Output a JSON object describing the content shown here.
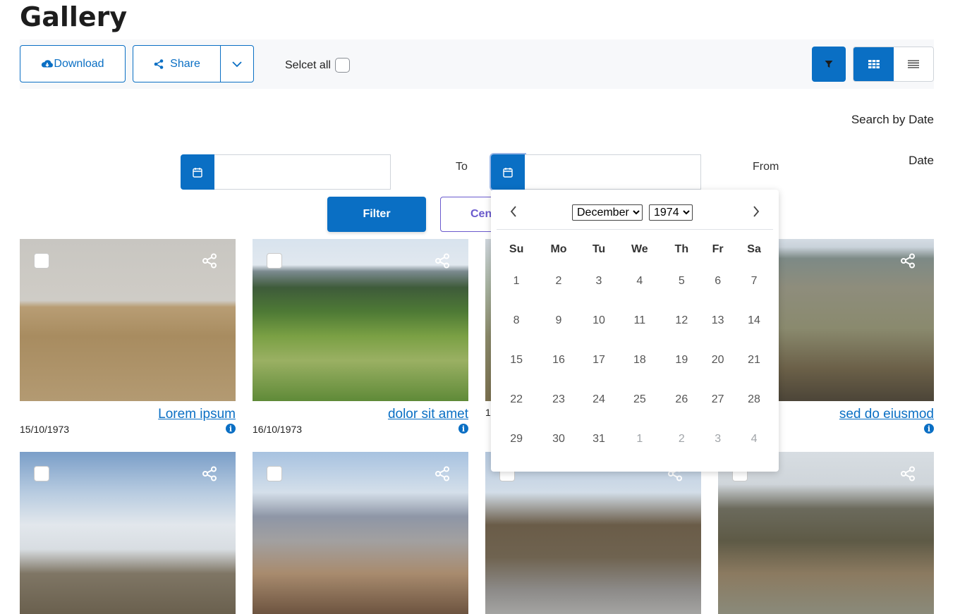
{
  "page": {
    "title": "Gallery"
  },
  "toolbar": {
    "download_label": "Download",
    "share_label": "Share",
    "select_all_label": "Selcet all"
  },
  "search": {
    "search_by_date": "Search by Date",
    "date_label": "Date",
    "to_label": "To",
    "from_label": "From",
    "filter_label": "Filter",
    "cancel_label": "Cen",
    "date_input_1": "",
    "date_input_2": ""
  },
  "datepicker": {
    "month": "December",
    "year": "1974",
    "weekdays": [
      "Su",
      "Mo",
      "Tu",
      "We",
      "Th",
      "Fr",
      "Sa"
    ],
    "weeks": [
      [
        "1",
        "2",
        "3",
        "4",
        "5",
        "6",
        "7"
      ],
      [
        "8",
        "9",
        "10",
        "11",
        "12",
        "13",
        "14"
      ],
      [
        "15",
        "16",
        "17",
        "18",
        "19",
        "20",
        "21"
      ],
      [
        "22",
        "23",
        "24",
        "25",
        "26",
        "27",
        "28"
      ],
      [
        "29",
        "30",
        "31",
        "1",
        "2",
        "3",
        "4"
      ]
    ]
  },
  "gallery": {
    "items": [
      {
        "title": "Lorem ipsum",
        "date": "15/10/1973"
      },
      {
        "title": "dolor sit amet",
        "date": "16/10/1973"
      },
      {
        "title": "",
        "date": "1"
      },
      {
        "title": "sed do eiusmod",
        "date": ""
      }
    ]
  },
  "colors": {
    "primary": "#0a6fc4",
    "cancel": "#6a5acd"
  }
}
